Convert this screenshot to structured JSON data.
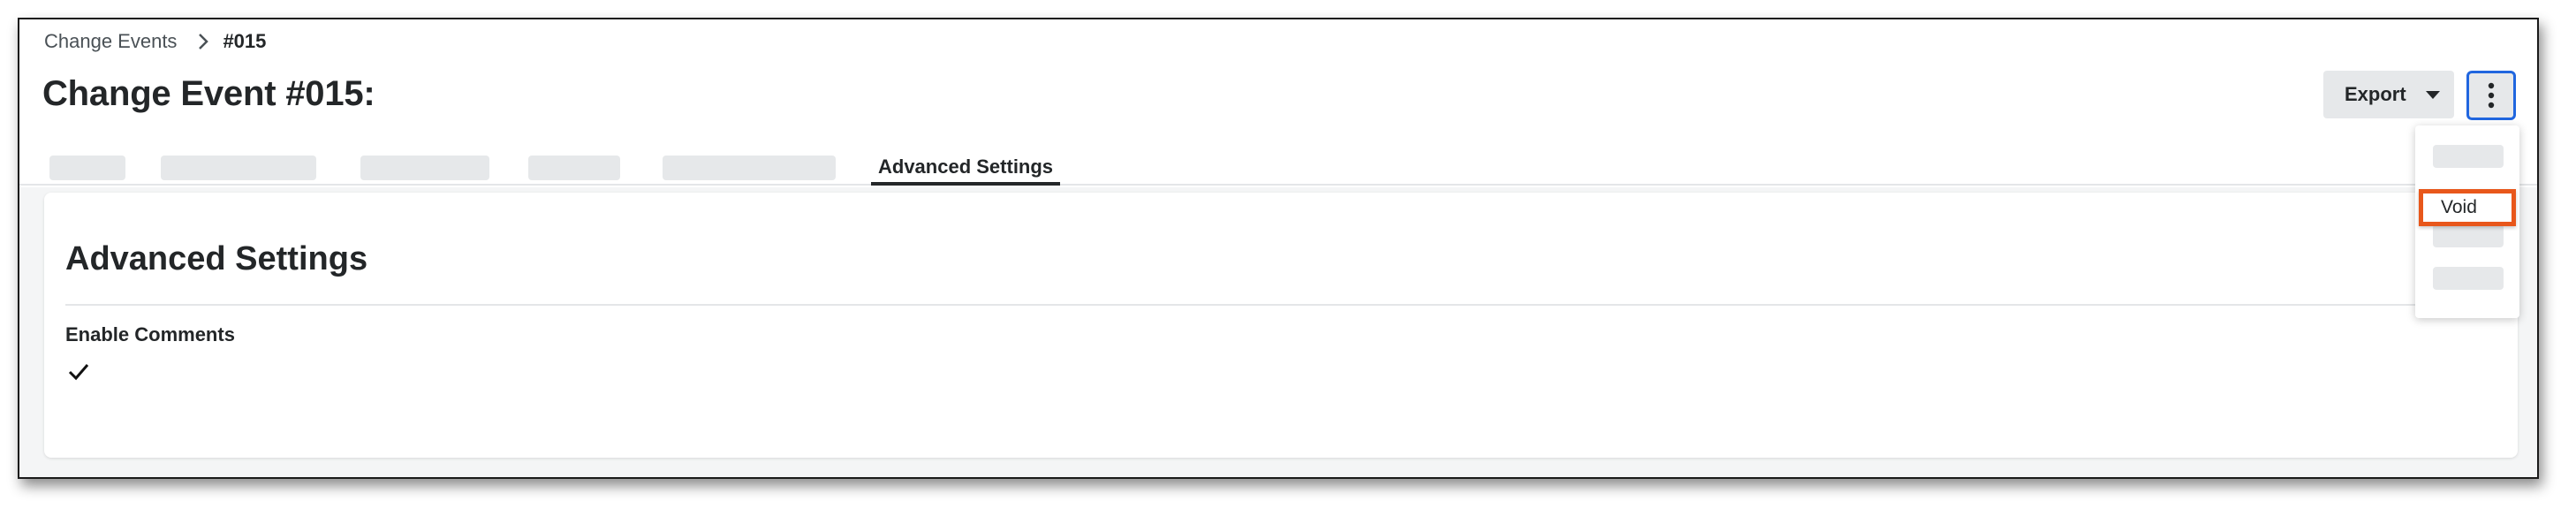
{
  "breadcrumb": {
    "parent": "Change Events",
    "current": "#015"
  },
  "page": {
    "title": "Change Event #015:"
  },
  "tabs": {
    "active_label": "Advanced Settings"
  },
  "actions": {
    "export_label": "Export",
    "more_icon": "more-vertical-icon"
  },
  "menu": {
    "void_label": "Void"
  },
  "section": {
    "title": "Advanced Settings",
    "field_label": "Enable Comments",
    "field_value_icon": "checkmark-icon"
  },
  "colors": {
    "accent_blue": "#2066df",
    "highlight_orange": "#e8571b",
    "placeholder_gray": "#e6e8ea",
    "text_dark": "#232628"
  }
}
